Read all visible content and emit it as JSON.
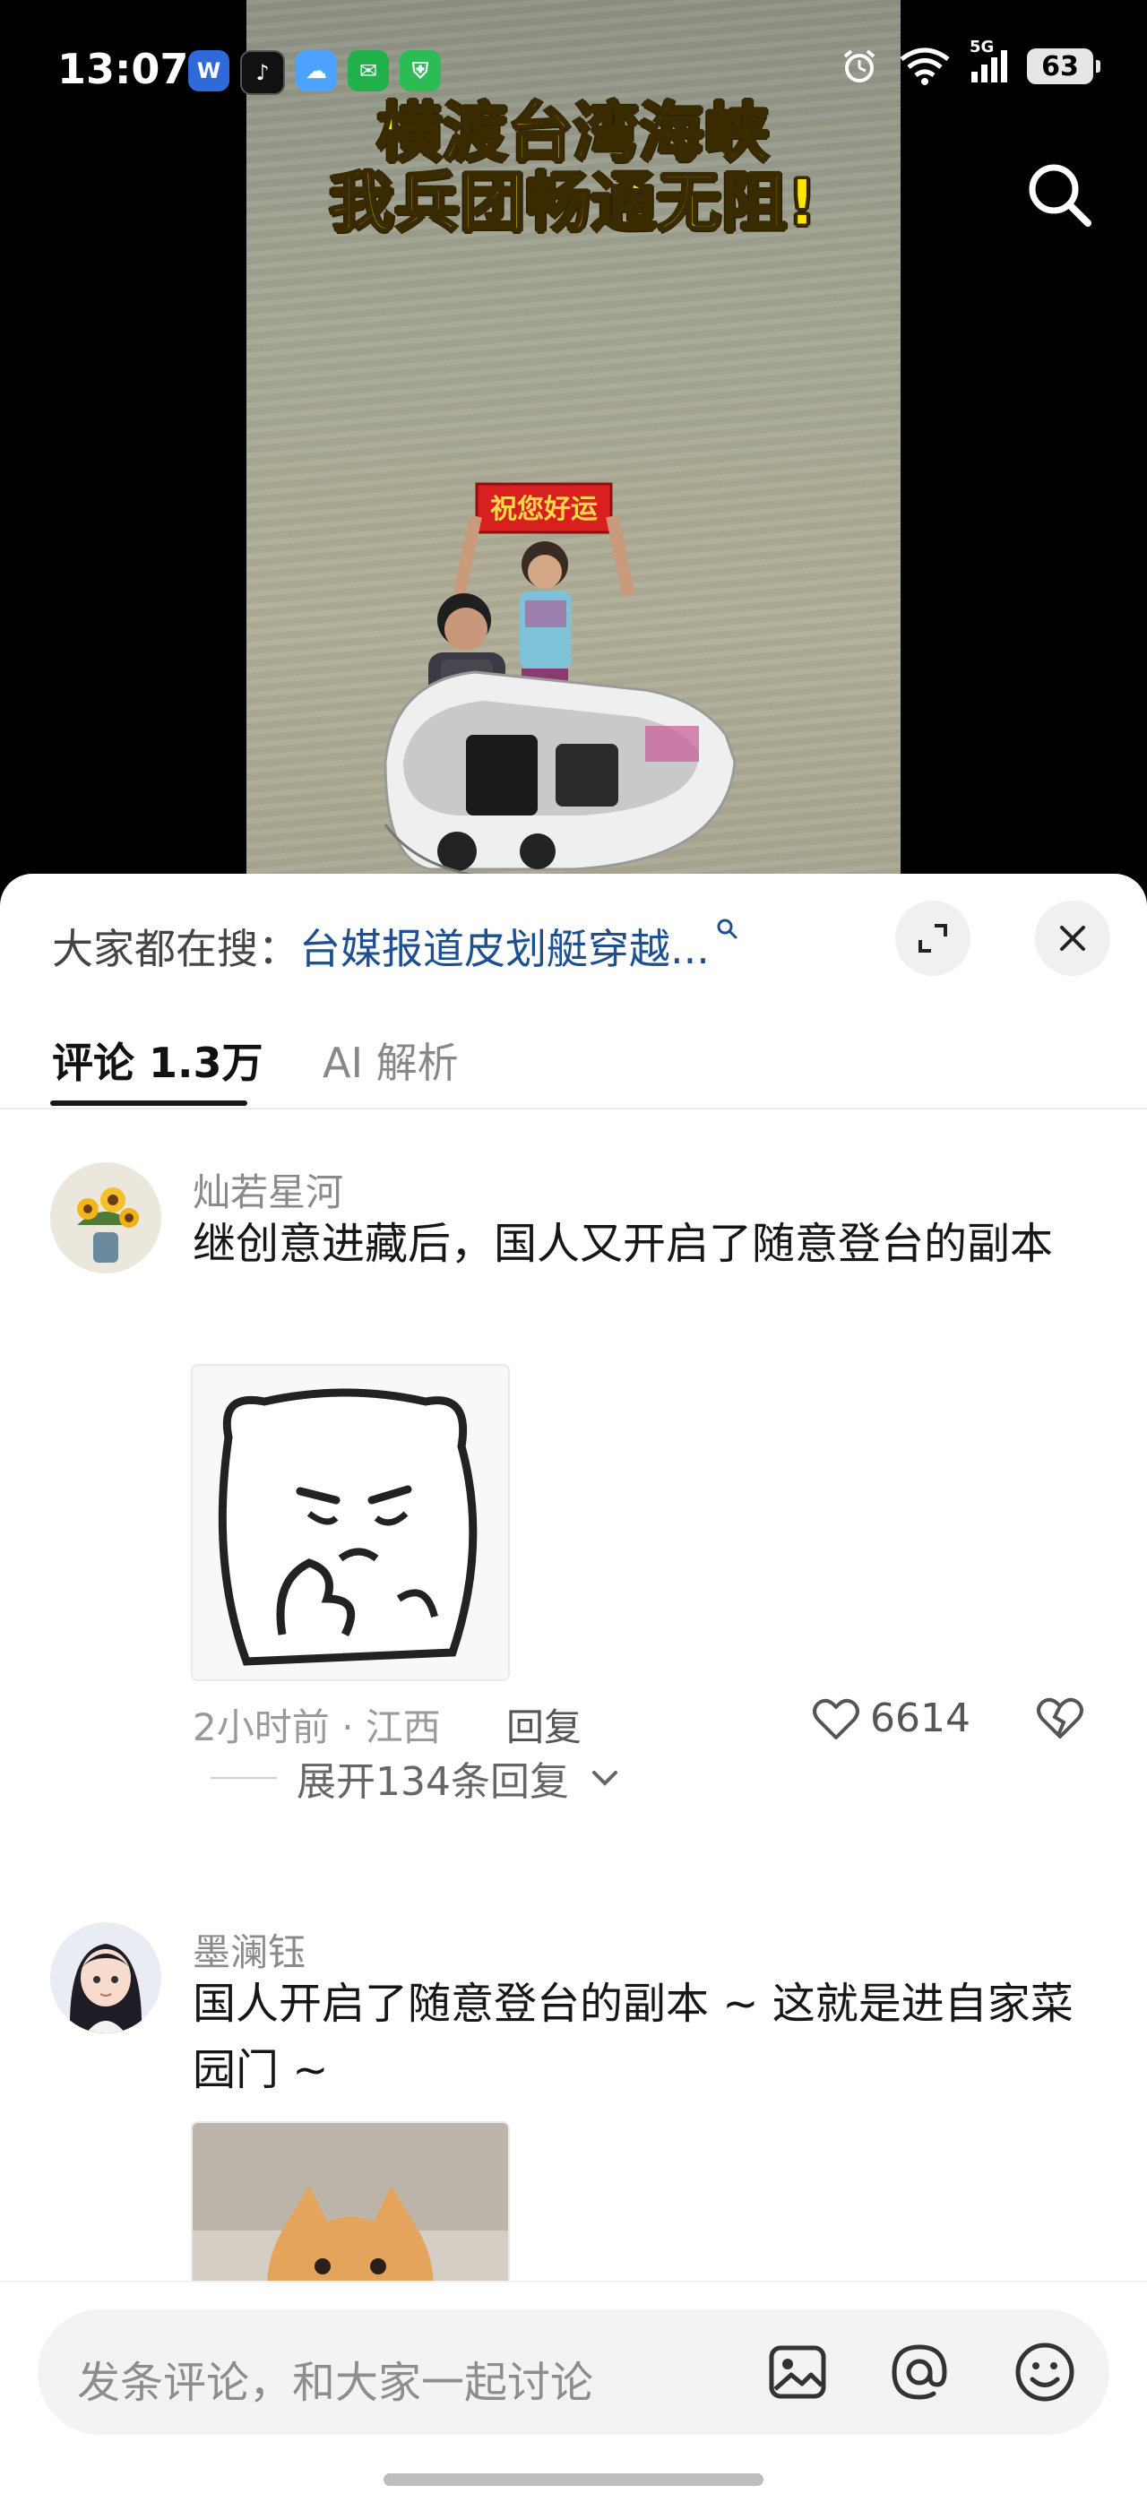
{
  "status_bar": {
    "time": "13:07",
    "battery": "63",
    "network": "5G",
    "app_icons": [
      "wps-icon",
      "tiktok-icon",
      "weather-icon",
      "message-icon",
      "shield-icon"
    ]
  },
  "video": {
    "caption_line1": "横渡台湾海峡",
    "caption_line2": "我兵团畅通无阻!",
    "banner_text": "祝您好运"
  },
  "hot_search": {
    "prefix": "大家都在搜：",
    "link": "台媒报道皮划艇穿越..."
  },
  "tabs": [
    {
      "label": "评论 1.3万",
      "active": true
    },
    {
      "label": "AI 解析",
      "active": false
    }
  ],
  "comments": [
    {
      "username": "灿若星河",
      "text": "继创意进藏后，国人又开启了随意登台的副本",
      "meta": "2小时前 · 江西",
      "reply_label": "回复",
      "likes": "6614",
      "expand_replies": "展开134条回复"
    },
    {
      "username": "墨澜钰",
      "text": "国人开启了随意登台的副本 ~ 这就是进自家菜园门 ~"
    }
  ],
  "input": {
    "placeholder": "发条评论，和大家一起讨论"
  },
  "colors": {
    "caption_yellow": "#ffe600",
    "link_blue": "#1d4f91",
    "banner_red": "#d8201e"
  }
}
